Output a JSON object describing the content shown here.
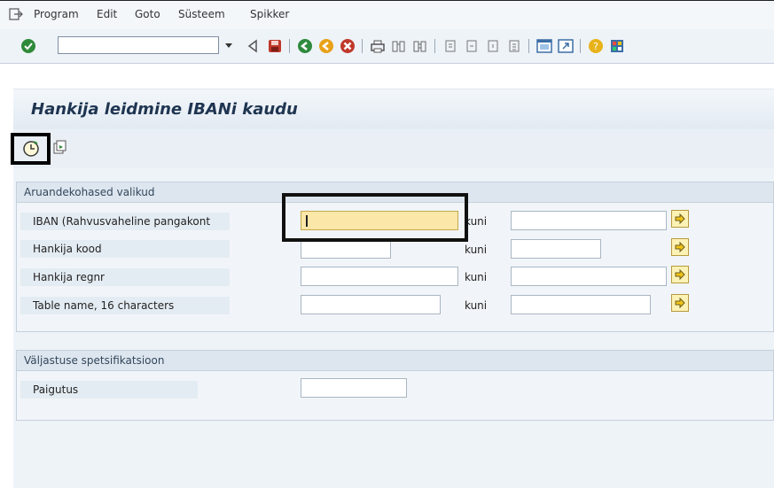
{
  "menu": {
    "icon": "exit-menu-icon",
    "items": [
      "Program",
      "Edit",
      "Goto",
      "Süsteem",
      "Spikker"
    ]
  },
  "toolbar": {
    "command_value": "",
    "icons": [
      "enter-checkmark-icon",
      "dropdown-icon",
      "back-triangle-icon",
      "save-icon",
      "back-icon",
      "exit-icon",
      "cancel-icon",
      "print-icon",
      "find-icon",
      "find-next-icon",
      "first-page-icon",
      "previous-page-icon",
      "next-page-icon",
      "last-page-icon",
      "create-session-icon",
      "shortcut-icon",
      "help-icon",
      "layout-icon"
    ]
  },
  "title": "Hankija leidmine IBANi kaudu",
  "app_toolbar": {
    "execute_icon": "execute-clock-icon",
    "variant_icon": "get-variant-icon"
  },
  "selection_group": {
    "header": "Aruandekohased valikud",
    "rows": [
      {
        "label": "IBAN (Rahvusvaheline pangakont",
        "to_label": "kuni"
      },
      {
        "label": "Hankija kood",
        "to_label": "kuni"
      },
      {
        "label": "Hankija regnr",
        "to_label": "kuni"
      },
      {
        "label": "Table name, 16 characters",
        "to_label": "kuni"
      }
    ]
  },
  "output_group": {
    "header": "Väljastuse spetsifikatsioon",
    "rows": [
      {
        "label": "Paigutus"
      }
    ]
  },
  "colors": {
    "active_field": "#fbe7a7",
    "title_text": "#1f3551",
    "highlight_border": "#000000"
  }
}
